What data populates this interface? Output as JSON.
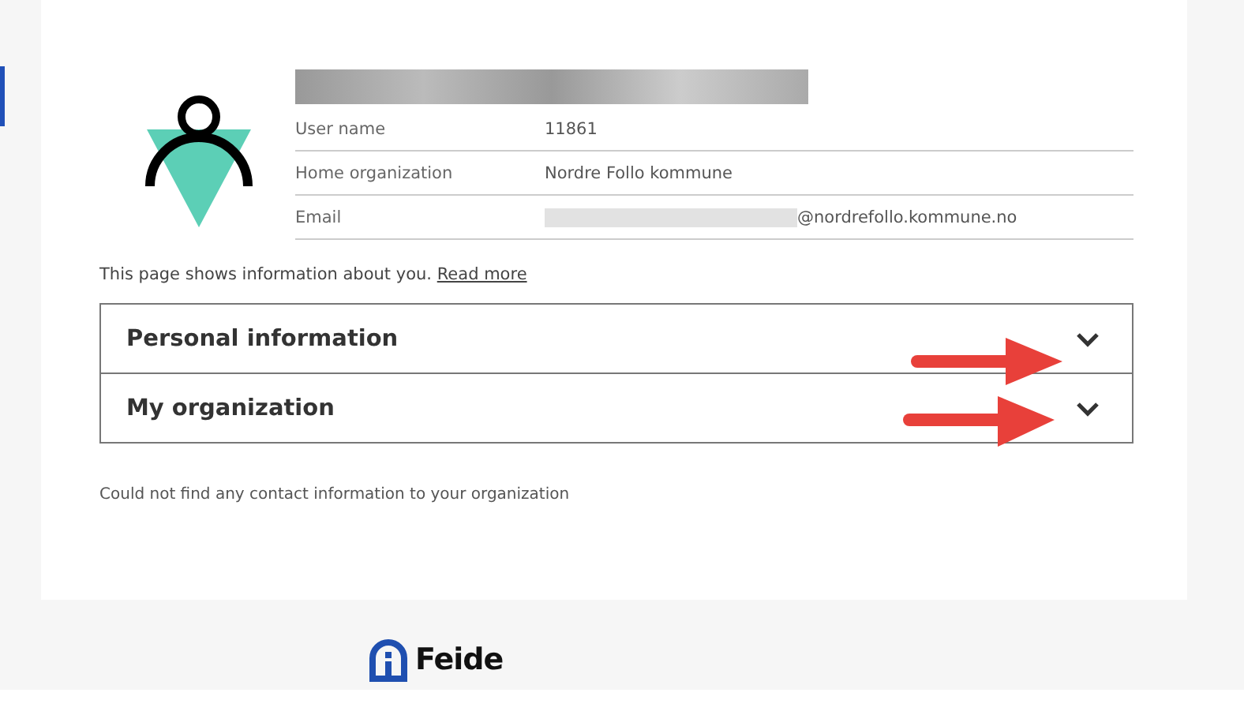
{
  "profile": {
    "rows": [
      {
        "label": "User name",
        "value": "11861",
        "redacted": false
      },
      {
        "label": "Home organization",
        "value": "Nordre Follo kommune",
        "redacted": false
      },
      {
        "label": "Email",
        "value": "@nordrefollo.kommune.no",
        "redacted": true
      }
    ]
  },
  "intro": {
    "text": "This page shows information about you.",
    "link": "Read more"
  },
  "sections": [
    {
      "title": "Personal information",
      "expanded": false
    },
    {
      "title": "My organization",
      "expanded": false
    }
  ],
  "notice": "Could not find any contact information to your organization",
  "footer": {
    "logo": "Feide"
  }
}
